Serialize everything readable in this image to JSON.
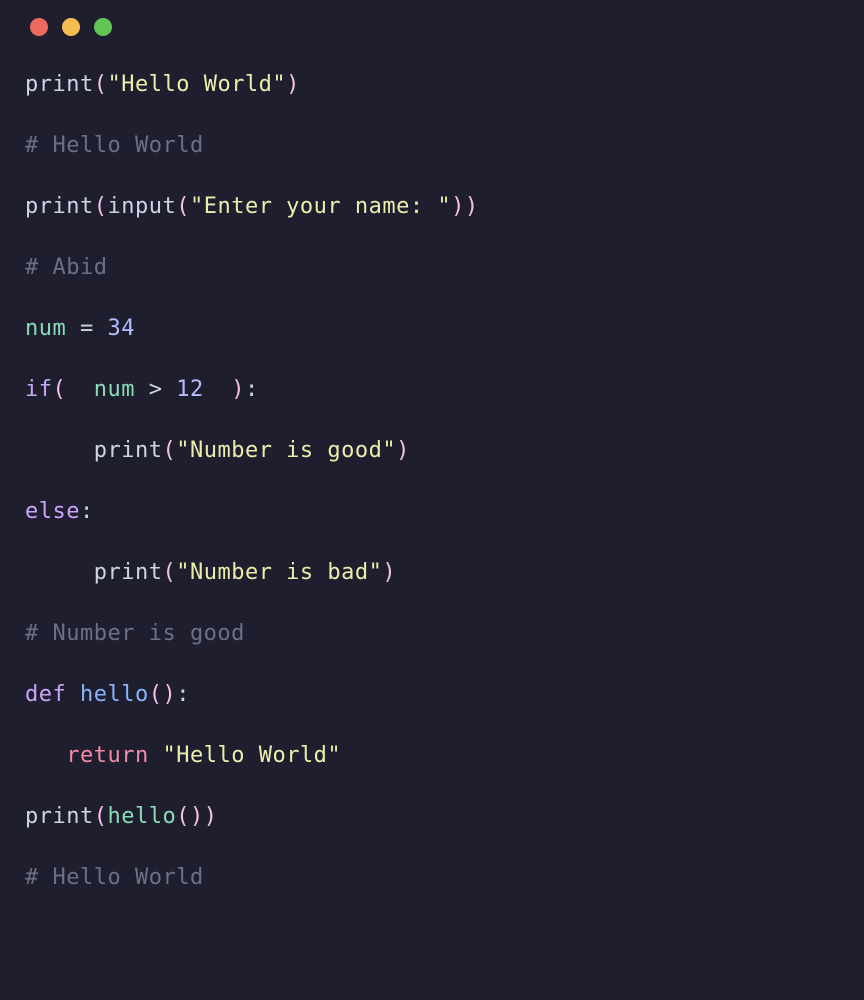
{
  "titlebar": {
    "dots": [
      "red",
      "yellow",
      "green"
    ]
  },
  "code": {
    "line1": {
      "print": "print",
      "op1": "(",
      "str": "\"Hello World\"",
      "op2": ")"
    },
    "line2": {
      "comment": "# Hello World"
    },
    "line3": {
      "print": "print",
      "op1": "(",
      "input": "input",
      "op2": "(",
      "str": "\"Enter your name: \"",
      "op3": ")",
      "op4": ")"
    },
    "line4": {
      "comment": "# Abid"
    },
    "line5": {
      "var": "num",
      "eq": " = ",
      "num": "34"
    },
    "line6": {
      "if": "if",
      "op1": "( ",
      "var": " num",
      "gt": " > ",
      "num": "12",
      "op2": "  )",
      "colon": ":"
    },
    "line7": {
      "indent": "     ",
      "print": "print",
      "op1": "(",
      "str": "\"Number is good\"",
      "op2": ")"
    },
    "line8": {
      "else": "else",
      "colon": ":"
    },
    "line9": {
      "indent": "     ",
      "print": "print",
      "op1": "(",
      "str": "\"Number is bad\"",
      "op2": ")"
    },
    "line10": {
      "comment": "# Number is good"
    },
    "line11": {
      "def": "def",
      "sp": " ",
      "name": "hello",
      "op1": "(",
      "op2": ")",
      "colon": ":"
    },
    "line12": {
      "indent": "   ",
      "return": "return",
      "sp": " ",
      "str": "\"Hello World\""
    },
    "line13": {
      "print": "print",
      "op1": "(",
      "call": "hello",
      "op2": "(",
      "op3": ")",
      "op4": ")"
    },
    "line14": {
      "comment": "# Hello World"
    }
  }
}
